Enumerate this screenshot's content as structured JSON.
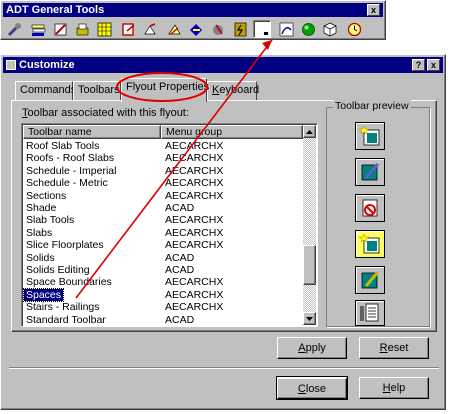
{
  "toolbar_window": {
    "title": "ADT General Tools",
    "close": "x",
    "icons": [
      "wrench-icon",
      "layers-icon",
      "cut-icon",
      "stack-icon",
      "grid-icon",
      "paint-icon",
      "display-icon",
      "roof-icon",
      "select-icon",
      "object-icon",
      "bolt-icon",
      "blank-button-icon",
      "spiral-icon",
      "green-dot-icon",
      "cube-icon",
      "clock-icon"
    ]
  },
  "dialog": {
    "title": "Customize",
    "help_btn": "?",
    "close_btn": "x",
    "tabs": [
      {
        "label": "Commands"
      },
      {
        "label": "Toolbars"
      },
      {
        "label": "Flyout Properties"
      },
      {
        "label": "Keyboard"
      }
    ],
    "list_label": "Toolbar associated with this flyout:",
    "columns": [
      "Toolbar name",
      "Menu group"
    ],
    "rows": [
      {
        "name": "Roof Slab Tools",
        "group": "AECARCHX"
      },
      {
        "name": "Roofs - Roof Slabs",
        "group": "AECARCHX"
      },
      {
        "name": "Schedule - Imperial",
        "group": "AECARCHX"
      },
      {
        "name": "Schedule - Metric",
        "group": "AECARCHX"
      },
      {
        "name": "Sections",
        "group": "AECARCHX"
      },
      {
        "name": "Shade",
        "group": "ACAD"
      },
      {
        "name": "Slab Tools",
        "group": "AECARCHX"
      },
      {
        "name": "Slabs",
        "group": "AECARCHX"
      },
      {
        "name": "Slice Floorplates",
        "group": "AECARCHX"
      },
      {
        "name": "Solids",
        "group": "ACAD"
      },
      {
        "name": "Solids Editing",
        "group": "ACAD"
      },
      {
        "name": "Space Boundaries",
        "group": "AECARCHX"
      },
      {
        "name": "Spaces",
        "group": "AECARCHX"
      },
      {
        "name": "Stairs - Railings",
        "group": "AECARCHX"
      },
      {
        "name": "Standard Toolbar",
        "group": "ACAD"
      }
    ],
    "selected_row": "Spaces",
    "preview_label": "Toolbar preview",
    "preview_icons": [
      "star-sheet-icon",
      "pencil-sheet-icon",
      "red-sheet-icon",
      "star-sheet-selected-icon",
      "pencil-sheet-2-icon",
      "document-lines-icon"
    ],
    "apply": "Apply",
    "reset": "Reset",
    "close": "Close",
    "help": "Help"
  },
  "colors": {
    "titlebar": "#000080",
    "face": "#c0c0c0",
    "annotation": "#e00000",
    "selection": "#000080"
  }
}
